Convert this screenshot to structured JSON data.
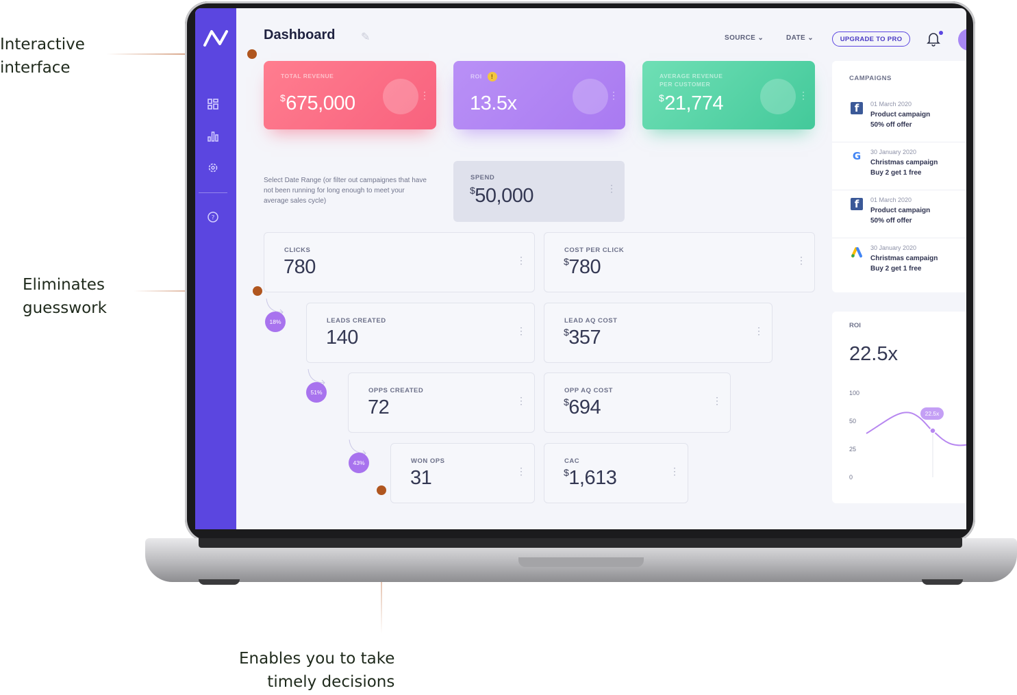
{
  "callouts": {
    "interactive": "Interactive\ninterface",
    "eliminates": "Eliminates\nguesswork",
    "enables": "Enables you to take\ntimely decisions"
  },
  "header": {
    "title": "Dashboard",
    "source_label": "SOURCE",
    "date_label": "DATE",
    "upgrade_label": "UPGRADE TO PRO"
  },
  "kpis": {
    "revenue": {
      "label": "TOTAL REVENUE",
      "currency": "$",
      "value": "675,000"
    },
    "roi": {
      "label": "ROI",
      "value": "13.5x",
      "warn": "!"
    },
    "arpc": {
      "label": "AVERAGE REVENUE\nPER CUSTOMER",
      "currency": "$",
      "value": "21,774"
    }
  },
  "note": "Select Date Range (or filter out campaignes that have not been running for long enough to meet your average sales cycle)",
  "spend": {
    "label": "SPEND",
    "currency": "$",
    "value": "50,000"
  },
  "funnel": {
    "clicks": {
      "label": "CLICKS",
      "value": "780"
    },
    "cpc": {
      "label": "COST PER CLICK",
      "currency": "$",
      "value": "780"
    },
    "leads": {
      "label": "LEADS CREATED",
      "value": "140"
    },
    "lead_cost": {
      "label": "LEAD AQ COST",
      "currency": "$",
      "value": "357"
    },
    "opps": {
      "label": "OPPS CREATED",
      "value": "72"
    },
    "opp_cost": {
      "label": "OPP AQ COST",
      "currency": "$",
      "value": "694"
    },
    "won": {
      "label": "WON OPS",
      "value": "31"
    },
    "cac": {
      "label": "CAC",
      "currency": "$",
      "value": "1,613"
    },
    "conv1": "18%",
    "conv2": "51%",
    "conv3": "43%"
  },
  "campaigns": {
    "title": "CAMPAIGNS",
    "items": [
      {
        "icon": "facebook-icon",
        "glyph": "f",
        "color": "#3b5998",
        "date": "01 March 2020",
        "name": "Product campaign",
        "offer": "50% off offer"
      },
      {
        "icon": "google-icon",
        "glyph": "G",
        "color": "#4285f4",
        "date": "30 January 2020",
        "name": "Christmas campaign",
        "offer": "Buy 2 get 1 free"
      },
      {
        "icon": "facebook-icon",
        "glyph": "f",
        "color": "#3b5998",
        "date": "01 March 2020",
        "name": "Product campaign",
        "offer": "50% off offer"
      },
      {
        "icon": "google-ads-icon",
        "glyph": "▲",
        "color": "#34a853",
        "date": "30 January 2020",
        "name": "Christmas campaign",
        "offer": "Buy 2 get 1 free"
      }
    ]
  },
  "roi_panel": {
    "label": "ROI",
    "value": "22.5x",
    "tooltip": "22.5x",
    "yticks": [
      "100",
      "50",
      "25",
      "0"
    ]
  },
  "colors": {
    "sidebar": "#5b46e0",
    "revenue_card": "#fb6f8a",
    "roi_card": "#b286f3",
    "arpc_card": "#5bd6a8",
    "callout_line": "#b85c28"
  }
}
